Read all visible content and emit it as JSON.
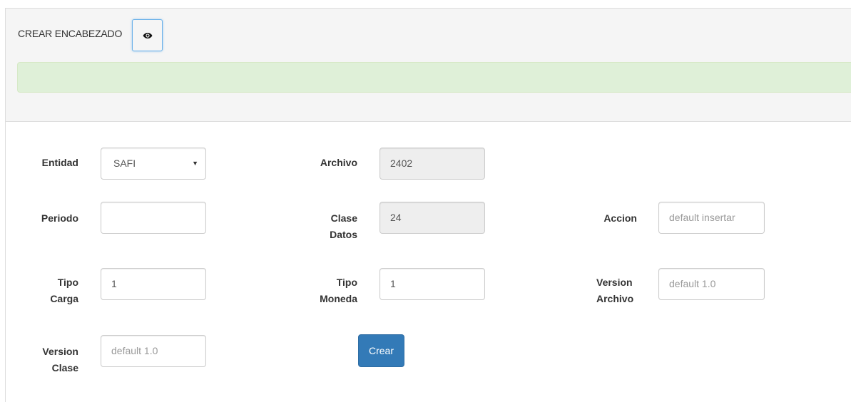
{
  "header": {
    "title": "CREAR ENCABEZADO",
    "toggle_icon": "eye-icon"
  },
  "form": {
    "entidad": {
      "label": "Entidad",
      "value": "SAFI"
    },
    "archivo": {
      "label": "Archivo",
      "value": "2402"
    },
    "periodo": {
      "label": "Periodo",
      "value": ""
    },
    "clase_datos": {
      "label_line1": "Clase",
      "label_line2": "Datos",
      "value": "24"
    },
    "accion": {
      "label": "Accion",
      "placeholder": "default insertar"
    },
    "tipo_carga": {
      "label_line1": "Tipo",
      "label_line2": "Carga",
      "value": "1"
    },
    "tipo_moneda": {
      "label_line1": "Tipo",
      "label_line2": "Moneda",
      "value": "1"
    },
    "version_archivo": {
      "label_line1": "Version",
      "label_line2": "Archivo",
      "placeholder": "default 1.0"
    },
    "version_clase": {
      "label_line1": "Version",
      "label_line2": "Clase",
      "placeholder": "default 1.0"
    },
    "submit_label": "Crear"
  },
  "colors": {
    "primary": "#337ab7",
    "alert_success_bg": "#dff0d8",
    "focus_border": "#66afe9"
  }
}
